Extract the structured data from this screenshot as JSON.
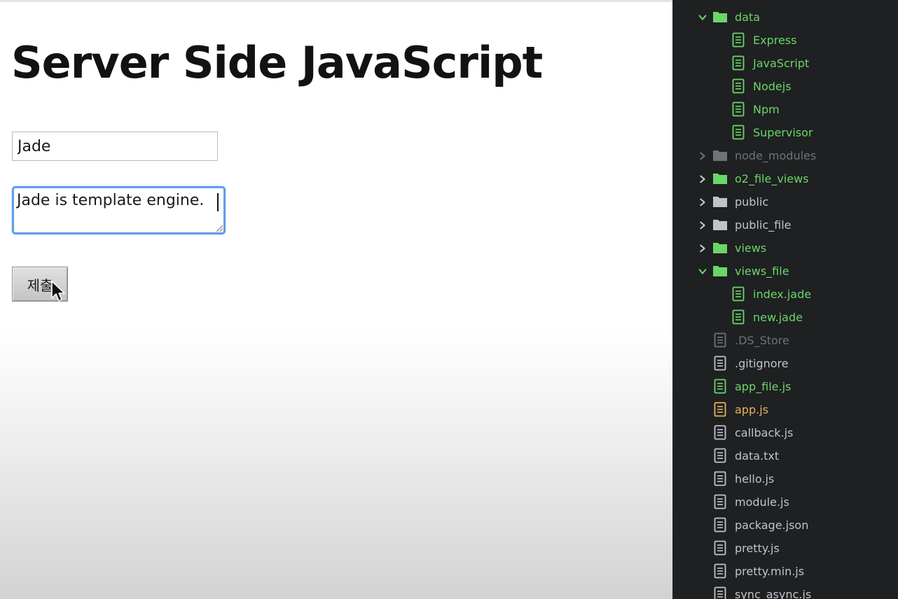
{
  "browser": {
    "heading": "Server Side JavaScript",
    "title_value": "Jade",
    "description_value": "Jade is template engine.",
    "submit_label": "제출"
  },
  "tree": {
    "items": [
      {
        "label": "data",
        "type": "folder",
        "expanded": true,
        "depth": 0,
        "status": "green"
      },
      {
        "label": "Express",
        "type": "file",
        "depth": 1,
        "status": "green"
      },
      {
        "label": "JavaScript",
        "type": "file",
        "depth": 1,
        "status": "green"
      },
      {
        "label": "Nodejs",
        "type": "file",
        "depth": 1,
        "status": "green"
      },
      {
        "label": "Npm",
        "type": "file",
        "depth": 1,
        "status": "green"
      },
      {
        "label": "Supervisor",
        "type": "file",
        "depth": 1,
        "status": "green"
      },
      {
        "label": "node_modules",
        "type": "folder",
        "expanded": false,
        "depth": 0,
        "status": "dim"
      },
      {
        "label": "o2_file_views",
        "type": "folder",
        "expanded": false,
        "depth": 0,
        "status": "green"
      },
      {
        "label": "public",
        "type": "folder",
        "expanded": false,
        "depth": 0,
        "status": "gray"
      },
      {
        "label": "public_file",
        "type": "folder",
        "expanded": false,
        "depth": 0,
        "status": "gray"
      },
      {
        "label": "views",
        "type": "folder",
        "expanded": false,
        "depth": 0,
        "status": "green"
      },
      {
        "label": "views_file",
        "type": "folder",
        "expanded": true,
        "depth": 0,
        "status": "green"
      },
      {
        "label": "index.jade",
        "type": "file",
        "depth": 1,
        "status": "green"
      },
      {
        "label": "new.jade",
        "type": "file",
        "depth": 1,
        "status": "green"
      },
      {
        "label": ".DS_Store",
        "type": "file",
        "depth": 0,
        "status": "dim"
      },
      {
        "label": ".gitignore",
        "type": "file",
        "depth": 0,
        "status": "gray"
      },
      {
        "label": "app_file.js",
        "type": "file",
        "depth": 0,
        "status": "green"
      },
      {
        "label": "app.js",
        "type": "file",
        "depth": 0,
        "status": "orange"
      },
      {
        "label": "callback.js",
        "type": "file",
        "depth": 0,
        "status": "gray"
      },
      {
        "label": "data.txt",
        "type": "file",
        "depth": 0,
        "status": "gray"
      },
      {
        "label": "hello.js",
        "type": "file",
        "depth": 0,
        "status": "gray"
      },
      {
        "label": "module.js",
        "type": "file",
        "depth": 0,
        "status": "gray"
      },
      {
        "label": "package.json",
        "type": "file",
        "depth": 0,
        "status": "gray"
      },
      {
        "label": "pretty.js",
        "type": "file",
        "depth": 0,
        "status": "gray"
      },
      {
        "label": "pretty.min.js",
        "type": "file",
        "depth": 0,
        "status": "gray"
      },
      {
        "label": "sync_async.js",
        "type": "file",
        "depth": 0,
        "status": "gray"
      }
    ]
  },
  "colors": {
    "green": "#6bd667",
    "gray": "#c0c4ca",
    "dim": "#6e737a",
    "orange": "#e8b25c",
    "focus_ring": "#5e9ee9"
  }
}
